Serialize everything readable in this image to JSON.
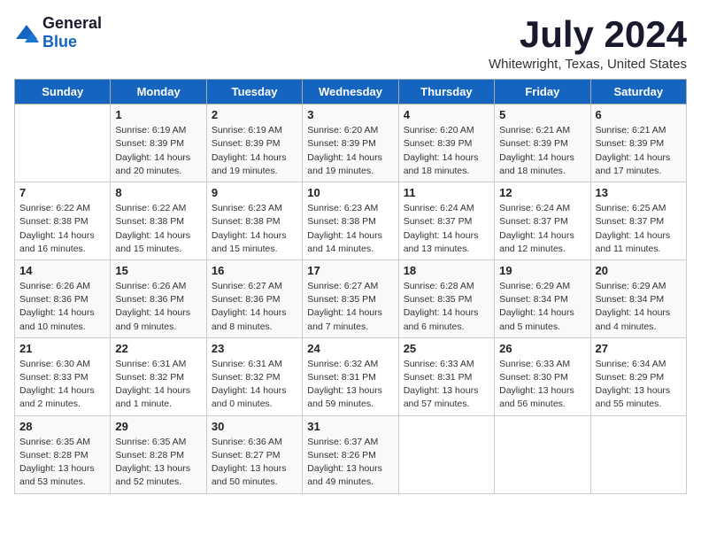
{
  "logo": {
    "text_general": "General",
    "text_blue": "Blue"
  },
  "header": {
    "month_title": "July 2024",
    "location": "Whitewright, Texas, United States"
  },
  "days_of_week": [
    "Sunday",
    "Monday",
    "Tuesday",
    "Wednesday",
    "Thursday",
    "Friday",
    "Saturday"
  ],
  "weeks": [
    [
      {
        "num": "",
        "info": ""
      },
      {
        "num": "1",
        "info": "Sunrise: 6:19 AM\nSunset: 8:39 PM\nDaylight: 14 hours\nand 20 minutes."
      },
      {
        "num": "2",
        "info": "Sunrise: 6:19 AM\nSunset: 8:39 PM\nDaylight: 14 hours\nand 19 minutes."
      },
      {
        "num": "3",
        "info": "Sunrise: 6:20 AM\nSunset: 8:39 PM\nDaylight: 14 hours\nand 19 minutes."
      },
      {
        "num": "4",
        "info": "Sunrise: 6:20 AM\nSunset: 8:39 PM\nDaylight: 14 hours\nand 18 minutes."
      },
      {
        "num": "5",
        "info": "Sunrise: 6:21 AM\nSunset: 8:39 PM\nDaylight: 14 hours\nand 18 minutes."
      },
      {
        "num": "6",
        "info": "Sunrise: 6:21 AM\nSunset: 8:39 PM\nDaylight: 14 hours\nand 17 minutes."
      }
    ],
    [
      {
        "num": "7",
        "info": "Sunrise: 6:22 AM\nSunset: 8:38 PM\nDaylight: 14 hours\nand 16 minutes."
      },
      {
        "num": "8",
        "info": "Sunrise: 6:22 AM\nSunset: 8:38 PM\nDaylight: 14 hours\nand 15 minutes."
      },
      {
        "num": "9",
        "info": "Sunrise: 6:23 AM\nSunset: 8:38 PM\nDaylight: 14 hours\nand 15 minutes."
      },
      {
        "num": "10",
        "info": "Sunrise: 6:23 AM\nSunset: 8:38 PM\nDaylight: 14 hours\nand 14 minutes."
      },
      {
        "num": "11",
        "info": "Sunrise: 6:24 AM\nSunset: 8:37 PM\nDaylight: 14 hours\nand 13 minutes."
      },
      {
        "num": "12",
        "info": "Sunrise: 6:24 AM\nSunset: 8:37 PM\nDaylight: 14 hours\nand 12 minutes."
      },
      {
        "num": "13",
        "info": "Sunrise: 6:25 AM\nSunset: 8:37 PM\nDaylight: 14 hours\nand 11 minutes."
      }
    ],
    [
      {
        "num": "14",
        "info": "Sunrise: 6:26 AM\nSunset: 8:36 PM\nDaylight: 14 hours\nand 10 minutes."
      },
      {
        "num": "15",
        "info": "Sunrise: 6:26 AM\nSunset: 8:36 PM\nDaylight: 14 hours\nand 9 minutes."
      },
      {
        "num": "16",
        "info": "Sunrise: 6:27 AM\nSunset: 8:36 PM\nDaylight: 14 hours\nand 8 minutes."
      },
      {
        "num": "17",
        "info": "Sunrise: 6:27 AM\nSunset: 8:35 PM\nDaylight: 14 hours\nand 7 minutes."
      },
      {
        "num": "18",
        "info": "Sunrise: 6:28 AM\nSunset: 8:35 PM\nDaylight: 14 hours\nand 6 minutes."
      },
      {
        "num": "19",
        "info": "Sunrise: 6:29 AM\nSunset: 8:34 PM\nDaylight: 14 hours\nand 5 minutes."
      },
      {
        "num": "20",
        "info": "Sunrise: 6:29 AM\nSunset: 8:34 PM\nDaylight: 14 hours\nand 4 minutes."
      }
    ],
    [
      {
        "num": "21",
        "info": "Sunrise: 6:30 AM\nSunset: 8:33 PM\nDaylight: 14 hours\nand 2 minutes."
      },
      {
        "num": "22",
        "info": "Sunrise: 6:31 AM\nSunset: 8:32 PM\nDaylight: 14 hours\nand 1 minute."
      },
      {
        "num": "23",
        "info": "Sunrise: 6:31 AM\nSunset: 8:32 PM\nDaylight: 14 hours\nand 0 minutes."
      },
      {
        "num": "24",
        "info": "Sunrise: 6:32 AM\nSunset: 8:31 PM\nDaylight: 13 hours\nand 59 minutes."
      },
      {
        "num": "25",
        "info": "Sunrise: 6:33 AM\nSunset: 8:31 PM\nDaylight: 13 hours\nand 57 minutes."
      },
      {
        "num": "26",
        "info": "Sunrise: 6:33 AM\nSunset: 8:30 PM\nDaylight: 13 hours\nand 56 minutes."
      },
      {
        "num": "27",
        "info": "Sunrise: 6:34 AM\nSunset: 8:29 PM\nDaylight: 13 hours\nand 55 minutes."
      }
    ],
    [
      {
        "num": "28",
        "info": "Sunrise: 6:35 AM\nSunset: 8:28 PM\nDaylight: 13 hours\nand 53 minutes."
      },
      {
        "num": "29",
        "info": "Sunrise: 6:35 AM\nSunset: 8:28 PM\nDaylight: 13 hours\nand 52 minutes."
      },
      {
        "num": "30",
        "info": "Sunrise: 6:36 AM\nSunset: 8:27 PM\nDaylight: 13 hours\nand 50 minutes."
      },
      {
        "num": "31",
        "info": "Sunrise: 6:37 AM\nSunset: 8:26 PM\nDaylight: 13 hours\nand 49 minutes."
      },
      {
        "num": "",
        "info": ""
      },
      {
        "num": "",
        "info": ""
      },
      {
        "num": "",
        "info": ""
      }
    ]
  ]
}
